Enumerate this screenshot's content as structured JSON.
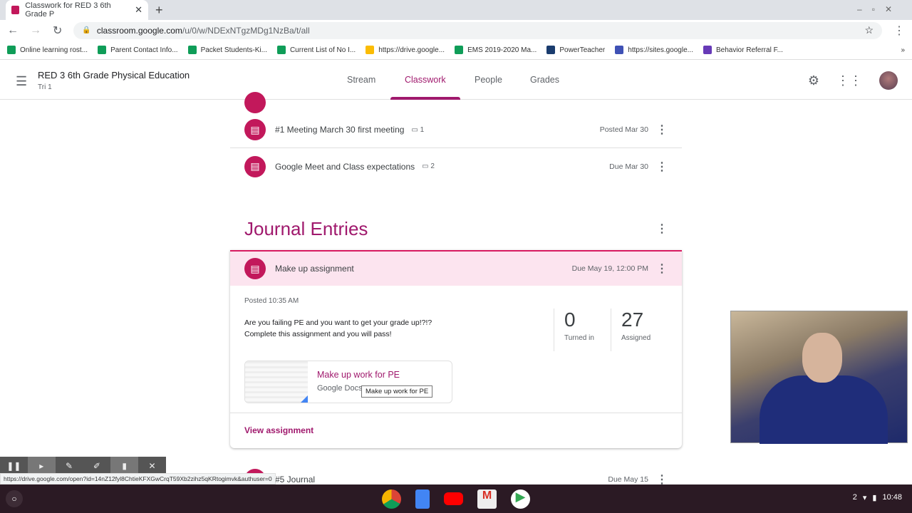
{
  "browser": {
    "tab_title": "Classwork for RED 3 6th Grade P",
    "url_host": "classroom.google.com",
    "url_path": "/u/0/w/NDExNTgzMDg1NzBa/t/all",
    "bookmarks": [
      {
        "label": "Online learning rost...",
        "color": "#0f9d58"
      },
      {
        "label": "Parent Contact Info...",
        "color": "#0f9d58"
      },
      {
        "label": "Packet Students-Ki...",
        "color": "#0f9d58"
      },
      {
        "label": "Current List of No I...",
        "color": "#0f9d58"
      },
      {
        "label": "https://drive.google...",
        "color": "#fbbc04"
      },
      {
        "label": "EMS 2019-2020 Ma...",
        "color": "#0f9d58"
      },
      {
        "label": "PowerTeacher",
        "color": "#1a3c6e"
      },
      {
        "label": "https://sites.google...",
        "color": "#3f51b5"
      },
      {
        "label": "Behavior Referral F...",
        "color": "#673ab7"
      }
    ],
    "status_url": "https://drive.google.com/open?id=14nZ12fyl8ChtieKFXGwCrqT59Xb2zihz5qKRtogimvk&authuser=0"
  },
  "class": {
    "title": "RED 3 6th Grade Physical Education",
    "subtitle": "Tri 1"
  },
  "nav": {
    "tabs": [
      "Stream",
      "Classwork",
      "People",
      "Grades"
    ],
    "active": "Classwork"
  },
  "accent": "#a0196d",
  "items": [
    {
      "title": "#1 Meeting March 30 first meeting",
      "comments": "1",
      "date": "Posted Mar 30"
    },
    {
      "title": "Google Meet and Class expectations",
      "comments": "2",
      "date": "Due Mar 30"
    }
  ],
  "topic": {
    "title": "Journal Entries"
  },
  "assignment": {
    "title": "Make up assignment",
    "due": "Due May 19, 12:00 PM",
    "posted": "Posted 10:35 AM",
    "description": "Are you failing PE and you want to get your grade up!?!?\nComplete this assignment and you will pass!",
    "turned_in": "0",
    "turned_in_label": "Turned in",
    "assigned": "27",
    "assigned_label": "Assigned",
    "attachment": {
      "title": "Make up work for PE",
      "type": "Google Docs",
      "tooltip": "Make up work for PE"
    },
    "view_label": "View assignment"
  },
  "next_item": {
    "title": "#5 Journal",
    "date": "Due May 15"
  },
  "tray": {
    "notifications": "2",
    "time": "10:48"
  }
}
